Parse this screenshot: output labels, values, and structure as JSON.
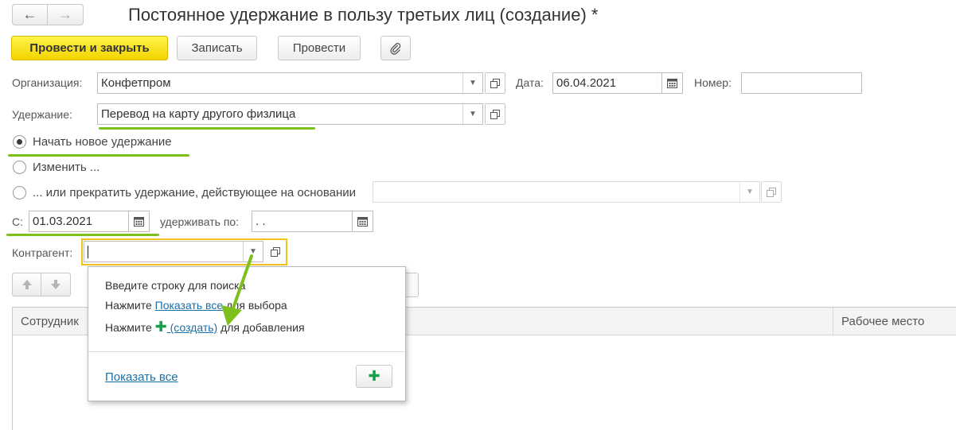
{
  "window": {
    "title": "Постоянное удержание в пользу третьих лиц (создание) *"
  },
  "nav": {
    "back_icon": "←",
    "forward_icon": "→"
  },
  "toolbar": {
    "post_close_label": "Провести и закрыть",
    "save_label": "Записать",
    "post_label": "Провести",
    "attach_icon": "paperclip-icon"
  },
  "form": {
    "org_label": "Организация:",
    "org_value": "Конфетпром",
    "date_label": "Дата:",
    "date_value": "06.04.2021",
    "number_label": "Номер:",
    "number_value": "",
    "deduction_label": "Удержание:",
    "deduction_value": "Перевод на карту другого физлица",
    "radio_new": "Начать новое удержание",
    "radio_change": "Изменить ...",
    "radio_stop": "... или прекратить удержание, действующее на основании",
    "stop_basis_value": "",
    "from_label": "С:",
    "from_value": "01.03.2021",
    "until_label": "удерживать по:",
    "until_value": " .  .",
    "contractor_label": "Контрагент:",
    "contractor_value": ""
  },
  "table": {
    "col_employee": "Сотрудник",
    "col_workplace": "Рабочее место"
  },
  "popup": {
    "line1": "Введите строку для поиска",
    "line2_prefix": "Нажмите ",
    "line2_link": "Показать все",
    "line2_suffix": " для выбора",
    "line3_prefix": "Нажмите ",
    "line3_link": " (создать)",
    "line3_suffix": " для добавления",
    "show_all": "Показать все"
  },
  "colors": {
    "primary_button": "#f2d400",
    "highlight_underline": "#7fbf1b",
    "focus_border": "#f0c419",
    "link": "#1a70a8",
    "plus": "#14a14a"
  }
}
